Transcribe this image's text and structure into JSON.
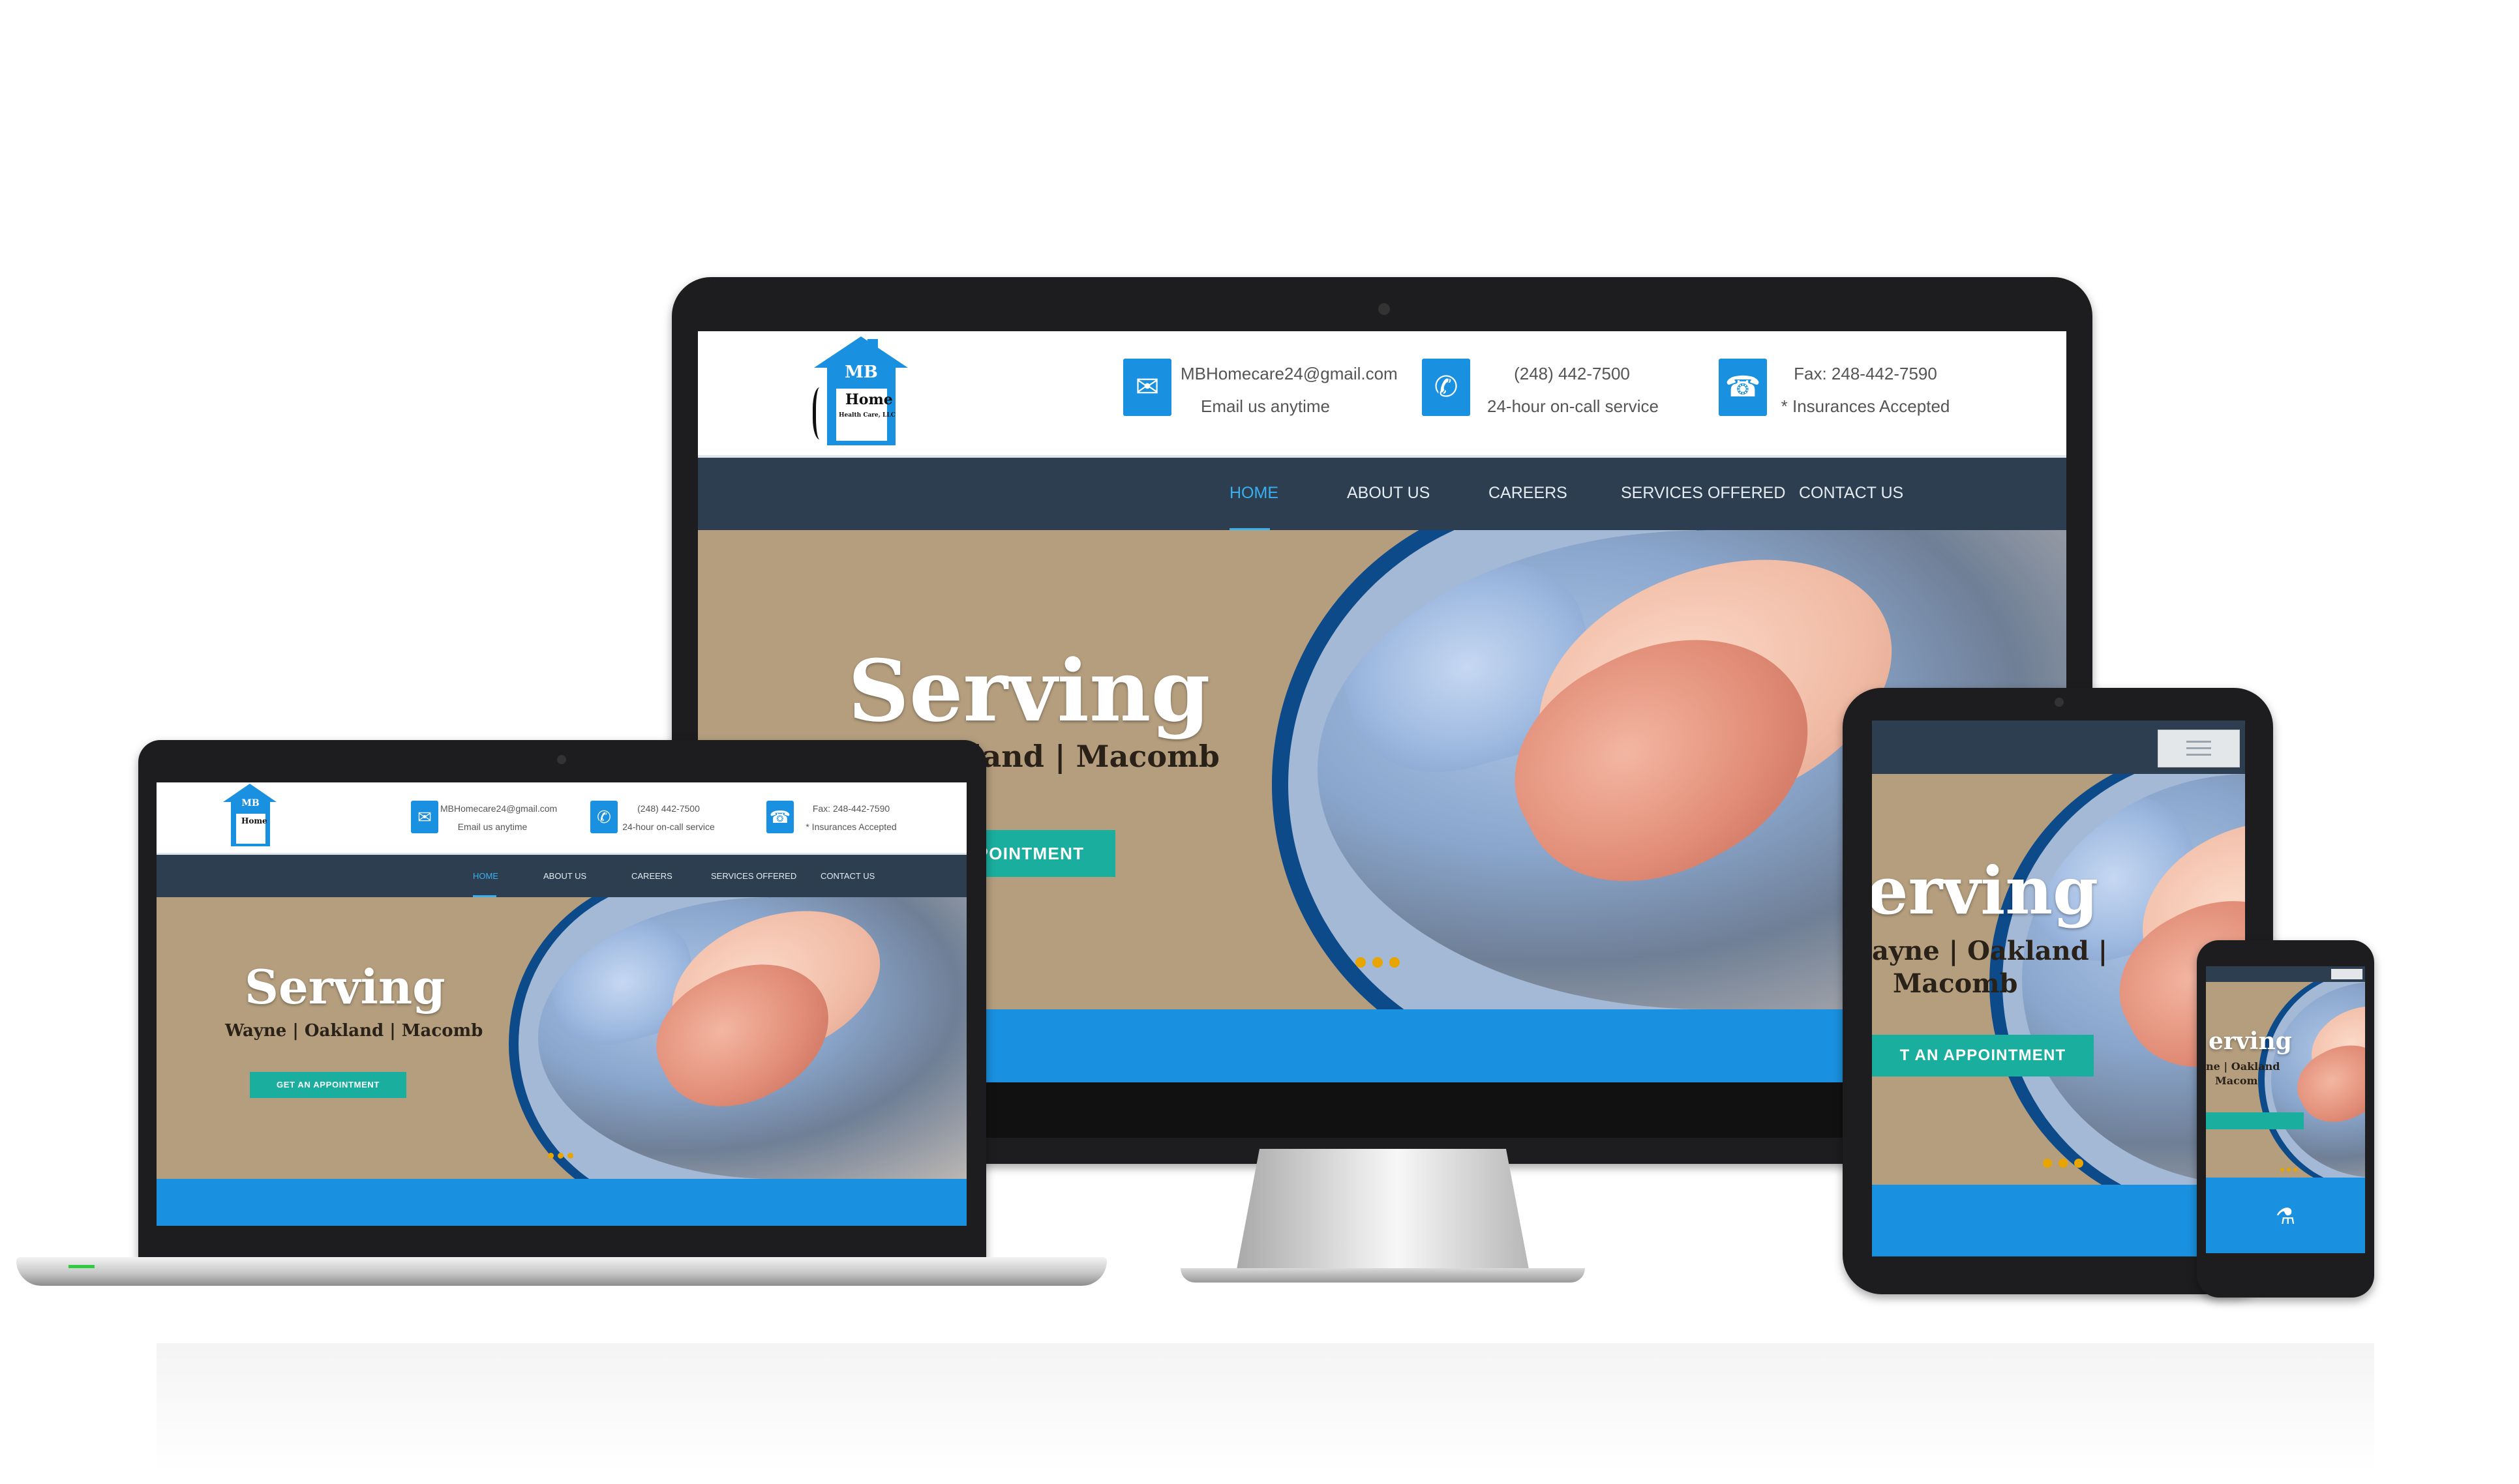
{
  "brand": {
    "logo_initials": "MB",
    "logo_word": "Home",
    "logo_sub": "Health Care, LLC"
  },
  "contact": {
    "email": "MBHomecare24@gmail.com",
    "email_note": "Email us anytime",
    "phone": "(248) 442-7500",
    "phone_note": "24-hour on-call service",
    "fax": "Fax: 248-442-7590",
    "fax_note": "* Insurances Accepted"
  },
  "nav": {
    "items": [
      "HOME",
      "ABOUT US",
      "CAREERS",
      "SERVICES OFFERED",
      "CONTACT US"
    ],
    "active": "HOME"
  },
  "hero": {
    "heading": "Serving",
    "regions": "Wayne | Oakland | Macomb",
    "regions_partial_desktop": "land | Macomb",
    "heading_partial_tablet": "erving",
    "regions_partial_tablet_1": "ayne | Oakland |",
    "regions_partial_tablet_2": "Macomb",
    "heading_partial_phone": "erving",
    "regions_partial_phone": "ne | Oakland",
    "regions_partial_phone_2": "Macom",
    "cta": "GET AN APPOINTMENT",
    "cta_partial_desktop": "POINTMENT",
    "cta_partial_tablet": "T AN APPOINTMENT"
  },
  "icons": {
    "email": "envelope-icon",
    "phone": "phone-icon",
    "fax": "fax-icon",
    "menu": "hamburger-menu-icon",
    "flask": "flask-icon"
  },
  "colors": {
    "accent_blue": "#1a91e0",
    "nav_dark": "#2c3e50",
    "cta_teal": "#1aae9f",
    "hero_tan": "#b49e7e",
    "slider_dot": "#e8a400",
    "nav_active": "#3ab0f0"
  }
}
